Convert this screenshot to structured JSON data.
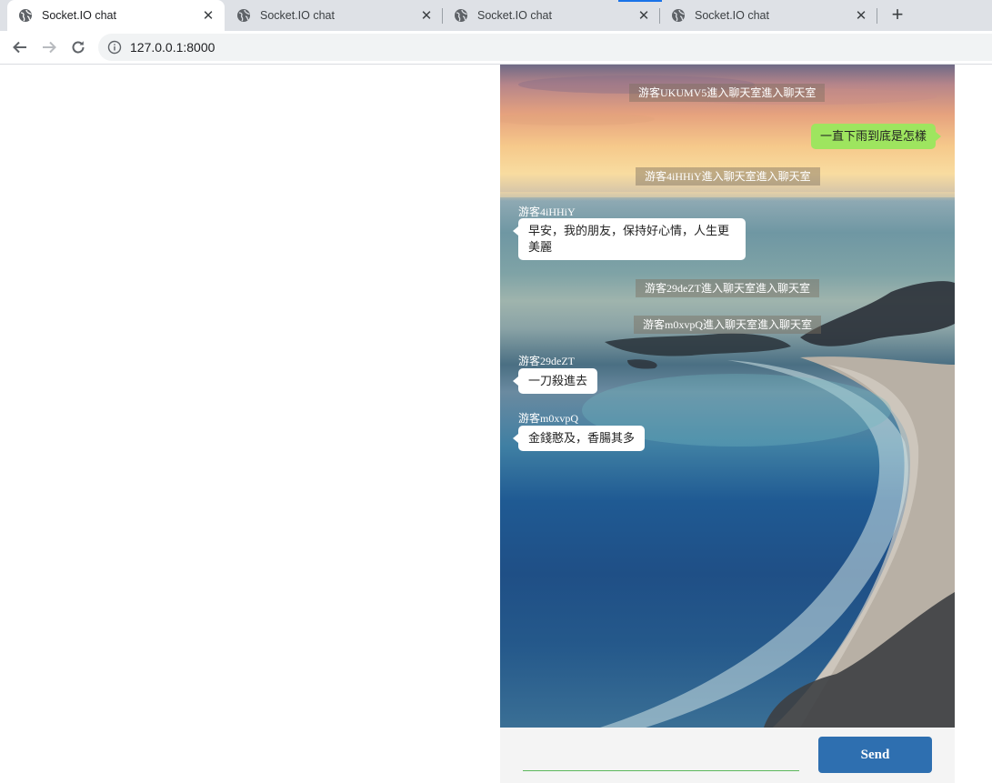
{
  "browser": {
    "tabs": [
      {
        "title": "Socket.IO chat",
        "active": true
      },
      {
        "title": "Socket.IO chat",
        "active": false
      },
      {
        "title": "Socket.IO chat",
        "active": false
      },
      {
        "title": "Socket.IO chat",
        "active": false
      }
    ],
    "new_tab_label": "+",
    "close_glyph": "✕",
    "url": "127.0.0.1:8000",
    "icons": {
      "back": "arrow-left-icon",
      "forward": "arrow-right-icon",
      "reload": "reload-icon",
      "site_info": "info-icon",
      "tab_favicon": "globe-icon"
    }
  },
  "chat": {
    "system_messages": [
      "游客UKUMV5進入聊天室進入聊天室",
      "游客4iHHiY進入聊天室進入聊天室",
      "游客29deZT進入聊天室進入聊天室",
      "游客m0xvpQ進入聊天室進入聊天室"
    ],
    "own_message": "一直下雨到底是怎樣",
    "messages": [
      {
        "user": "游客4iHHiY",
        "text": "早安，我的朋友，保持好心情，人生更美麗"
      },
      {
        "user": "游客29deZT",
        "text": "一刀殺進去"
      },
      {
        "user": "游客m0xvpQ",
        "text": "金錢憨及，香腸其多"
      }
    ],
    "input": {
      "value": "",
      "placeholder": ""
    },
    "send_label": "Send",
    "colors": {
      "own_bubble": "#9ee55f",
      "send_button": "#2e6fb0",
      "input_underline": "#5cb85c"
    }
  }
}
